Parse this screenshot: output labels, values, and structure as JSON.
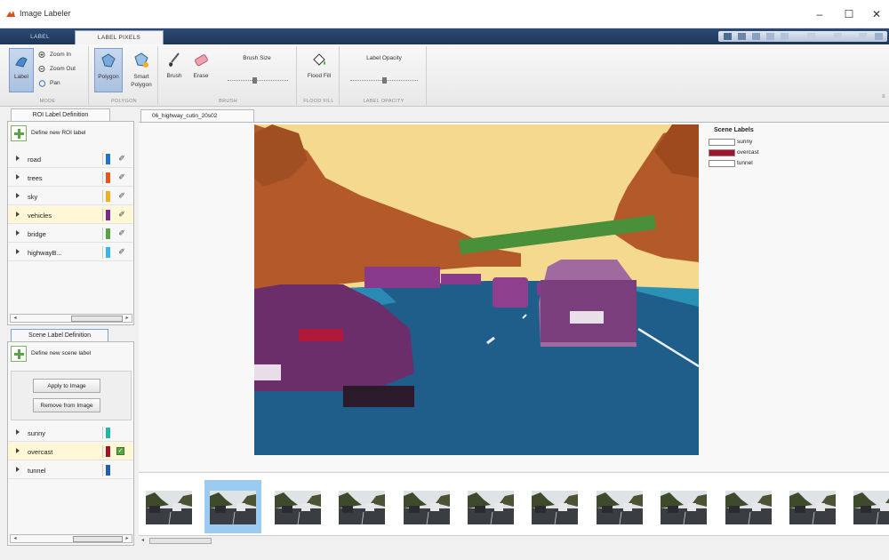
{
  "window": {
    "title": "Image Labeler",
    "min": "–",
    "max": "☐",
    "close": "✕"
  },
  "tabs": [
    {
      "label": "LABEL"
    },
    {
      "label": "LABEL PIXELS"
    }
  ],
  "ribbon": {
    "mode": {
      "label_btn": "Label",
      "zoom_in": "Zoom In",
      "zoom_out": "Zoom Out",
      "pan": "Pan",
      "group": "MODE"
    },
    "polygon": {
      "polygon": "Polygon",
      "smart_polygon": "Smart\nPolygon",
      "group": "POLYGON"
    },
    "brush": {
      "brush": "Brush",
      "erase": "Erase",
      "brush_size": "Brush Size",
      "group": "BRUSH"
    },
    "flood": {
      "flood_fill": "Flood Fill",
      "group": "FLOOD FILL"
    },
    "opacity": {
      "label": "Label Opacity",
      "group": "LABEL OPACITY"
    }
  },
  "roi_panel": {
    "tab": "ROI Label Definition",
    "define": "Define new ROI label",
    "labels": [
      {
        "name": "road",
        "color": "#1e73d2"
      },
      {
        "name": "trees",
        "color": "#e8541c"
      },
      {
        "name": "sky",
        "color": "#f0b21a"
      },
      {
        "name": "vehicles",
        "color": "#7a2a8c"
      },
      {
        "name": "bridge",
        "color": "#5aa342"
      },
      {
        "name": "highwayB...",
        "color": "#35b6ec"
      }
    ]
  },
  "scene_panel": {
    "tab": "Scene Label Definition",
    "define": "Define new scene label",
    "apply": "Apply to Image",
    "remove": "Remove from Image",
    "labels": [
      {
        "name": "sunny",
        "color": "#21b7a4"
      },
      {
        "name": "overcast",
        "color": "#a3142c",
        "checked": "✓"
      },
      {
        "name": "tunnel",
        "color": "#1e5fb4"
      }
    ]
  },
  "document": {
    "tab": "06_highway_cutin_20s02"
  },
  "scene_legend": {
    "title": "Scene Labels",
    "items": [
      {
        "name": "sunny",
        "color": "#ffffff"
      },
      {
        "name": "overcast",
        "color": "#a3142c"
      },
      {
        "name": "tunnel",
        "color": "#ffffff"
      }
    ]
  },
  "colors": {
    "sky": "#f5d98f",
    "trees": "#b45a2a",
    "road": "#1f5e8a",
    "vehicles": "#6b2e6a",
    "bridge": "#4a8f3a"
  },
  "filmstrip": {
    "frames": 12,
    "selected": 2
  }
}
